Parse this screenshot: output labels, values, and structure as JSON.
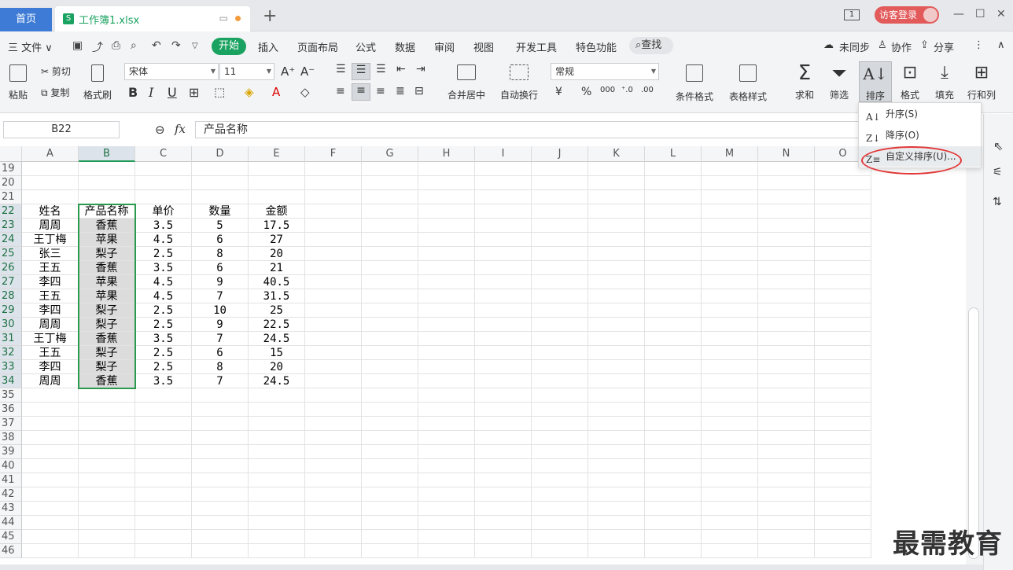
{
  "tabs": {
    "home": "首页",
    "file": "工作簿1.xlsx",
    "new": "+"
  },
  "window": {
    "page": "1",
    "login": "访客登录",
    "minimize": "—",
    "maximize": "☐",
    "close": "✕"
  },
  "menu": {
    "file": "三 文件 ∨",
    "items": [
      "开始",
      "插入",
      "页面布局",
      "公式",
      "数据",
      "审阅",
      "视图",
      "开发工具",
      "特色功能"
    ],
    "search": "查找",
    "right": [
      "未同步",
      "协作",
      "分享"
    ]
  },
  "ribbon": {
    "paste": "粘贴",
    "cut": "剪切",
    "copy": "复制",
    "format_painter": "格式刷",
    "font": "宋体",
    "size": "11",
    "merge": "合并居中",
    "wrap": "自动换行",
    "number_format": "常规",
    "cond_format": "条件格式",
    "table_style": "表格样式",
    "sum": "求和",
    "filter": "筛选",
    "sort": "排序",
    "format": "格式",
    "fill": "填充",
    "rowcol": "行和列"
  },
  "formula": {
    "name_box": "B22",
    "fx": "fx",
    "value": "产品名称"
  },
  "columns": [
    "A",
    "B",
    "C",
    "D",
    "E",
    "F",
    "G",
    "H",
    "I",
    "J",
    "K",
    "L",
    "M",
    "N",
    "O"
  ],
  "rows": [
    "19",
    "20",
    "21",
    "22",
    "23",
    "24",
    "25",
    "26",
    "27",
    "28",
    "29",
    "30",
    "31",
    "32",
    "33",
    "34",
    "35",
    "36",
    "37",
    "38",
    "39",
    "40",
    "41",
    "42",
    "43",
    "44",
    "45",
    "46"
  ],
  "table": [
    [
      "姓名",
      "产品名称",
      "单价",
      "数量",
      "金额"
    ],
    [
      "周周",
      "香蕉",
      "3.5",
      "5",
      "17.5"
    ],
    [
      "王丁梅",
      "苹果",
      "4.5",
      "6",
      "27"
    ],
    [
      "张三",
      "梨子",
      "2.5",
      "8",
      "20"
    ],
    [
      "王五",
      "香蕉",
      "3.5",
      "6",
      "21"
    ],
    [
      "李四",
      "苹果",
      "4.5",
      "9",
      "40.5"
    ],
    [
      "王五",
      "苹果",
      "4.5",
      "7",
      "31.5"
    ],
    [
      "李四",
      "梨子",
      "2.5",
      "10",
      "25"
    ],
    [
      "周周",
      "梨子",
      "2.5",
      "9",
      "22.5"
    ],
    [
      "王丁梅",
      "香蕉",
      "3.5",
      "7",
      "24.5"
    ],
    [
      "王五",
      "梨子",
      "2.5",
      "6",
      "15"
    ],
    [
      "李四",
      "梨子",
      "2.5",
      "8",
      "20"
    ],
    [
      "周周",
      "香蕉",
      "3.5",
      "7",
      "24.5"
    ]
  ],
  "sort_menu": {
    "asc": "升序(S)",
    "desc": "降序(O)",
    "custom": "自定义排序(U)..."
  },
  "watermark": "最需教育",
  "accent": "#1aa260"
}
